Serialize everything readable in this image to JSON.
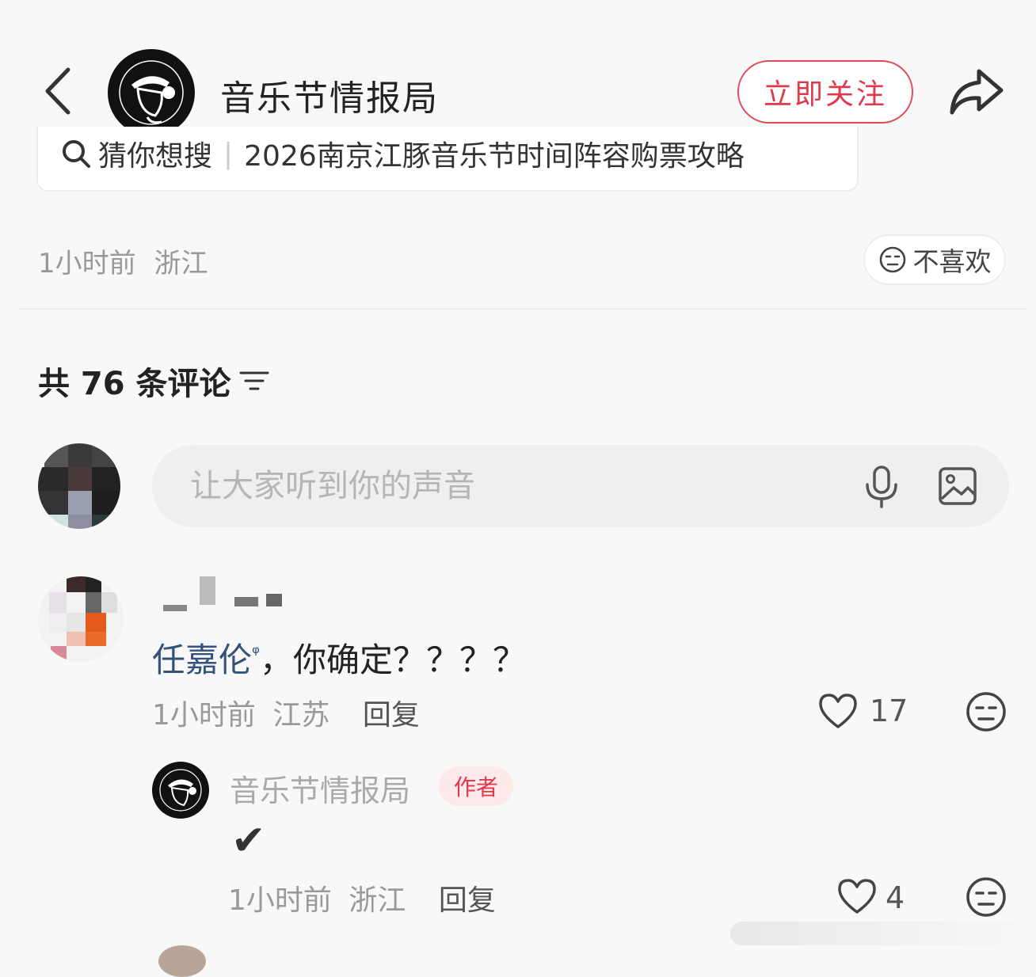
{
  "header": {
    "title": "音乐节情报局",
    "follow_label": "立即关注"
  },
  "guess_search": {
    "label": "猜你想搜",
    "query": "2026南京江豚音乐节时间阵容购票攻略"
  },
  "post_meta": {
    "time": "1小时前",
    "location": "浙江",
    "dislike_label": "不喜欢"
  },
  "comments": {
    "count_label": "共 76 条评论"
  },
  "input": {
    "placeholder": "让大家听到你的声音"
  },
  "comment1": {
    "mention": "任嘉伦",
    "text": "，你确定？？？？",
    "time": "1小时前",
    "location": "江苏",
    "reply_label": "回复",
    "likes": "17"
  },
  "reply1": {
    "user": "音乐节情报局",
    "badge": "作者",
    "text": "✔",
    "time": "1小时前",
    "location": "浙江",
    "reply_label": "回复",
    "likes": "4"
  },
  "colors": {
    "accent": "#e0394b",
    "mention": "#34527a"
  }
}
